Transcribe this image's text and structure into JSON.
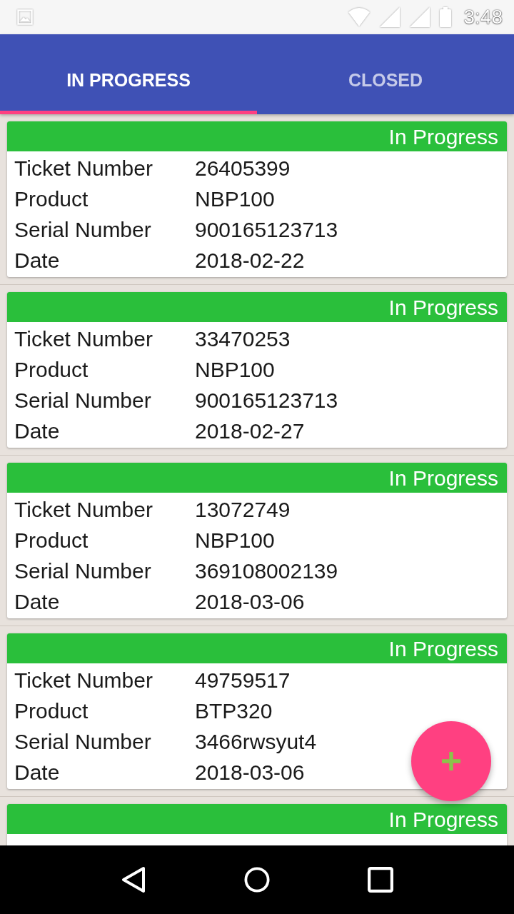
{
  "status_bar": {
    "time": "3:48"
  },
  "tabs": [
    {
      "label": "IN PROGRESS",
      "selected": true
    },
    {
      "label": "CLOSED",
      "selected": false
    }
  ],
  "tickets": [
    {
      "status": "In Progress",
      "fields": [
        {
          "label": "Ticket Number",
          "value": "26405399"
        },
        {
          "label": "Product",
          "value": "NBP100"
        },
        {
          "label": "Serial Number",
          "value": "900165123713"
        },
        {
          "label": "Date",
          "value": "2018-02-22"
        }
      ]
    },
    {
      "status": "In Progress",
      "fields": [
        {
          "label": "Ticket Number",
          "value": "33470253"
        },
        {
          "label": "Product",
          "value": "NBP100"
        },
        {
          "label": "Serial Number",
          "value": "900165123713"
        },
        {
          "label": "Date",
          "value": "2018-02-27"
        }
      ]
    },
    {
      "status": "In Progress",
      "fields": [
        {
          "label": "Ticket Number",
          "value": "13072749"
        },
        {
          "label": "Product",
          "value": "NBP100"
        },
        {
          "label": "Serial Number",
          "value": "369108002139"
        },
        {
          "label": "Date",
          "value": "2018-03-06"
        }
      ]
    },
    {
      "status": "In Progress",
      "fields": [
        {
          "label": "Ticket Number",
          "value": "49759517"
        },
        {
          "label": "Product",
          "value": "BTP320"
        },
        {
          "label": "Serial Number",
          "value": "3466rwsyut4"
        },
        {
          "label": "Date",
          "value": "2018-03-06"
        }
      ]
    },
    {
      "status": "In Progress"
    }
  ]
}
